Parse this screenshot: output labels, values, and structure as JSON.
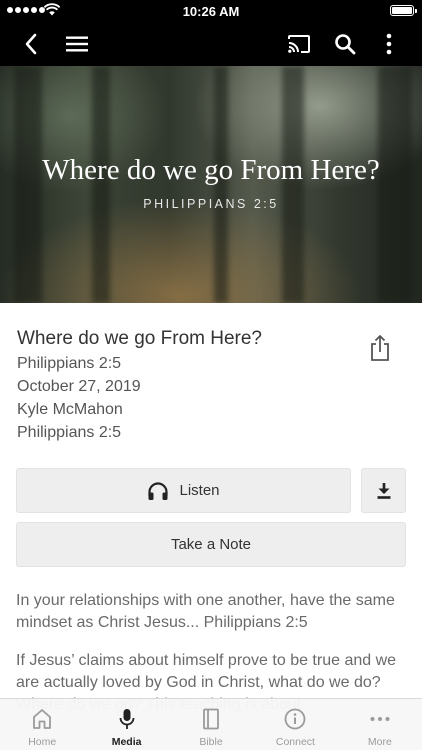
{
  "status_bar": {
    "time": "10:26 AM"
  },
  "hero": {
    "title": "Where do we go From Here?",
    "subtitle": "PHILIPPIANS 2:5"
  },
  "details": {
    "title": "Where do we go From Here?",
    "scripture": "Philippians 2:5",
    "date": "October 27, 2019",
    "speaker": "Kyle McMahon",
    "scripture_ref": "Philippians 2:5"
  },
  "actions": {
    "listen_label": "Listen",
    "note_label": "Take a Note"
  },
  "description": {
    "paragraph_1": "In your relationships with one another, have the same mindset as Christ Jesus... Philippians 2:5",
    "paragraph_2": "If Jesus’ claims about himself prove to be true and we are actually loved by God in Christ, what do we do? Where do we go? This teaching is about"
  },
  "tab_bar": {
    "active": "Media",
    "tabs": [
      {
        "label": "Home",
        "icon": "home-icon"
      },
      {
        "label": "Media",
        "icon": "microphone-icon"
      },
      {
        "label": "Bible",
        "icon": "book-icon"
      },
      {
        "label": "Connect",
        "icon": "info-icon"
      },
      {
        "label": "More",
        "icon": "more-dots-icon"
      }
    ]
  }
}
